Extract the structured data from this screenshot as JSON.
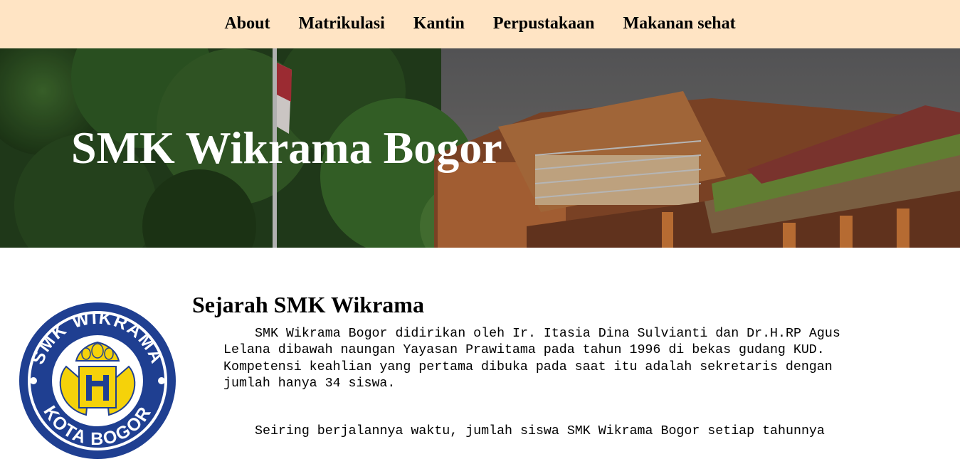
{
  "nav": {
    "items": [
      {
        "label": "About"
      },
      {
        "label": "Matrikulasi"
      },
      {
        "label": "Kantin"
      },
      {
        "label": "Perpustakaan"
      },
      {
        "label": "Makanan sehat"
      }
    ]
  },
  "hero": {
    "title": "SMK Wikrama Bogor"
  },
  "logo": {
    "text_top": "SMK WIKRAMA",
    "text_bottom": "KOTA BOGOR"
  },
  "content": {
    "heading": "Sejarah SMK Wikrama",
    "paragraphs": [
      "SMK Wikrama Bogor didirikan oleh Ir. Itasia Dina Sulvianti dan Dr.H.RP Agus Lelana dibawah naungan Yayasan Prawitama pada tahun 1996 di bekas gudang KUD. Kompetensi keahlian yang pertama dibuka pada saat itu adalah sekretaris dengan jumlah hanya 34 siswa.",
      "Seiring berjalannya waktu, jumlah siswa SMK Wikrama Bogor setiap tahunnya"
    ]
  },
  "colors": {
    "navbar_bg": "#ffe4c4",
    "logo_blue": "#1f3f91",
    "logo_yellow": "#f5d20a"
  }
}
